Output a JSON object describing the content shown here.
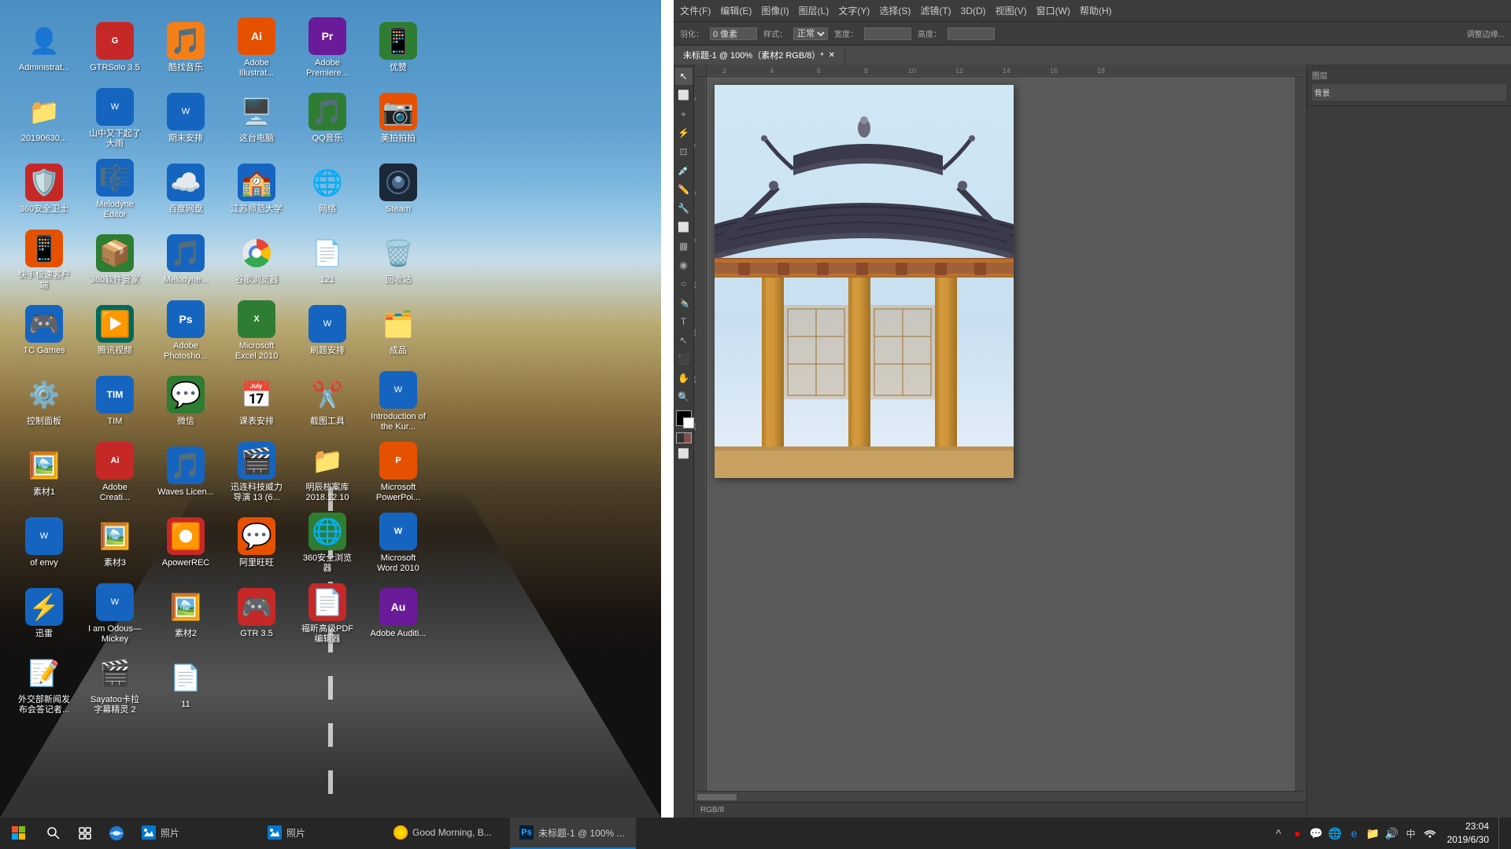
{
  "desktop": {
    "icons": [
      {
        "id": "my-computer",
        "label": "这台电脑",
        "emoji": "🖥️",
        "color": "icon-blue"
      },
      {
        "id": "qq-music",
        "label": "QQ音乐",
        "emoji": "🎵",
        "color": "icon-green"
      },
      {
        "id": "beauty-camera",
        "label": "美拍拍拍",
        "emoji": "📷",
        "color": "icon-orange"
      },
      {
        "id": "360-security",
        "label": "360安全卫士",
        "emoji": "🛡️",
        "color": "icon-red"
      },
      {
        "id": "melodyne-editor",
        "label": "Melodyne Editor",
        "emoji": "🎼",
        "color": "icon-blue"
      },
      {
        "id": "baidu-pan",
        "label": "百度网盘",
        "emoji": "☁️",
        "color": "icon-blue"
      },
      {
        "id": "jiangsu-normal",
        "label": "江苏师范大学",
        "emoji": "🏫",
        "color": "icon-blue"
      },
      {
        "id": "network",
        "label": "网络",
        "emoji": "🌐",
        "color": "icon-none"
      },
      {
        "id": "steam",
        "label": "Steam",
        "emoji": "🎮",
        "color": "icon-none"
      },
      {
        "id": "kuaishou",
        "label": "快手极速客户端",
        "emoji": "📱",
        "color": "icon-orange"
      },
      {
        "id": "360-compress",
        "label": "360软件管家",
        "emoji": "📦",
        "color": "icon-green"
      },
      {
        "id": "melodyne2",
        "label": "Melodyne...",
        "emoji": "🎵",
        "color": "icon-blue"
      },
      {
        "id": "chrome",
        "label": "谷歌浏览器",
        "emoji": "🌐",
        "color": "icon-red"
      },
      {
        "id": "file-121",
        "label": "121",
        "emoji": "📄",
        "color": "icon-none"
      },
      {
        "id": "recycle",
        "label": "回收站",
        "emoji": "🗑️",
        "color": "icon-none"
      },
      {
        "id": "tc-games",
        "label": "TC Games",
        "emoji": "🎮",
        "color": "icon-blue"
      },
      {
        "id": "tencent-video",
        "label": "腾讯视频",
        "emoji": "▶️",
        "color": "icon-teal"
      },
      {
        "id": "ps",
        "label": "Adobe Photosho...",
        "emoji": "Ps",
        "color": "icon-blue"
      },
      {
        "id": "excel2010",
        "label": "Microsoft Excel 2010",
        "emoji": "📊",
        "color": "icon-green"
      },
      {
        "id": "shuati",
        "label": "刷题安排",
        "emoji": "📝",
        "color": "icon-blue"
      },
      {
        "id": "chengpin",
        "label": "成品",
        "emoji": "🗂️",
        "color": "icon-none"
      },
      {
        "id": "control-panel",
        "label": "控制面板",
        "emoji": "⚙️",
        "color": "icon-none"
      },
      {
        "id": "tim",
        "label": "TIM",
        "emoji": "💬",
        "color": "icon-blue"
      },
      {
        "id": "wechat",
        "label": "微信",
        "emoji": "💬",
        "color": "icon-green"
      },
      {
        "id": "kebiao",
        "label": "课表安排",
        "emoji": "📅",
        "color": "icon-none"
      },
      {
        "id": "jiedian",
        "label": "截图工具",
        "emoji": "✂️",
        "color": "icon-none"
      },
      {
        "id": "introduction-kur",
        "label": "Introduction of the Kur...",
        "emoji": "📄",
        "color": "icon-blue"
      },
      {
        "id": "sucai1",
        "label": "素材1",
        "emoji": "🖼️",
        "color": "icon-none"
      },
      {
        "id": "adobe-creative",
        "label": "Adobe Creati...",
        "emoji": "Ai",
        "color": "icon-red"
      },
      {
        "id": "waves",
        "label": "Waves Licen...",
        "emoji": "🎵",
        "color": "icon-blue"
      },
      {
        "id": "xunlian",
        "label": "迅连科技威力导演 13 (6...",
        "emoji": "🎬",
        "color": "icon-blue"
      },
      {
        "id": "mingchen",
        "label": "明辰档案库 2018.12.10",
        "emoji": "📁",
        "color": "icon-none"
      },
      {
        "id": "powerpoint",
        "label": "Microsoft PowerPoi...",
        "emoji": "📊",
        "color": "icon-orange"
      },
      {
        "id": "of-envy",
        "label": "of envy",
        "emoji": "📄",
        "color": "icon-blue"
      },
      {
        "id": "sucai3",
        "label": "素材3",
        "emoji": "🖼️",
        "color": "icon-none"
      },
      {
        "id": "apowerrec",
        "label": "ApowerREC",
        "emoji": "⏺️",
        "color": "icon-red"
      },
      {
        "id": "alibaba",
        "label": "阿里旺旺",
        "emoji": "💬",
        "color": "icon-orange"
      },
      {
        "id": "360-browser",
        "label": "360安全浏览器",
        "emoji": "🌐",
        "color": "icon-green"
      },
      {
        "id": "word2010",
        "label": "Microsoft Word 2010",
        "emoji": "📝",
        "color": "icon-blue"
      },
      {
        "id": "xunda",
        "label": "迅雷",
        "emoji": "⚡",
        "color": "icon-blue"
      },
      {
        "id": "i-am-odus",
        "label": "I am Odous—Mickey",
        "emoji": "📄",
        "color": "icon-blue"
      },
      {
        "id": "sucai2",
        "label": "素材2",
        "emoji": "🖼️",
        "color": "icon-none"
      },
      {
        "id": "gtr35",
        "label": "GTR 3.5",
        "emoji": "🎮",
        "color": "icon-red"
      },
      {
        "id": "gaoxiao-pdf",
        "label": "福昕高级PDF编辑器",
        "emoji": "📄",
        "color": "icon-red"
      },
      {
        "id": "adobe-audition",
        "label": "Adobe Auditi...",
        "emoji": "Au",
        "color": "icon-purple"
      },
      {
        "id": "waijiao",
        "label": "外交部新闻发布会答记者...",
        "emoji": "📝",
        "color": "icon-none"
      },
      {
        "id": "sayatoo",
        "label": "Sayatoo卡拉字幕精灵 2",
        "emoji": "🎬",
        "color": "icon-none"
      },
      {
        "id": "file-11",
        "label": "11",
        "emoji": "📄",
        "color": "icon-none"
      },
      {
        "id": "administrator",
        "label": "Administrat...",
        "emoji": "👤",
        "color": "icon-none"
      },
      {
        "id": "gtrsolo",
        "label": "GTRSolo 3.5",
        "emoji": "🎮",
        "color": "icon-red"
      },
      {
        "id": "zuomei",
        "label": "酷找音乐",
        "emoji": "🎵",
        "color": "icon-yellow"
      },
      {
        "id": "ai",
        "label": "Adobe Illustrat...",
        "emoji": "Ai",
        "color": "icon-orange"
      },
      {
        "id": "premiere",
        "label": "Adobe Premiere...",
        "emoji": "Pr",
        "color": "icon-purple"
      },
      {
        "id": "youzan",
        "label": "优赞",
        "emoji": "📱",
        "color": "icon-green"
      },
      {
        "id": "file-20190630",
        "label": "20190630...",
        "emoji": "📁",
        "color": "icon-none"
      },
      {
        "id": "wenzhang",
        "label": "山中又下起了大雨",
        "emoji": "📄",
        "color": "icon-blue"
      },
      {
        "id": "qimo",
        "label": "期末安排",
        "emoji": "📄",
        "color": "icon-blue"
      }
    ]
  },
  "photoshop": {
    "title": "未标题-1 @ 100%（素材2 RGB/8）*",
    "menubar": [
      "文件(F)",
      "编辑(E)",
      "图像(I)",
      "图层(L)",
      "文字(Y)",
      "选择(S)",
      "滤镜(T)",
      "3D(D)",
      "视图(V)",
      "窗口(W)",
      "帮助(H)"
    ],
    "toolbar": {
      "羽化": "0 像素",
      "样式": "正常",
      "宽度": "",
      "高度": ""
    },
    "tab": "未标题-1 @ 100%（素材2 RGB/8）*",
    "status": "RGB/8",
    "zoom": "100%"
  },
  "taskbar": {
    "apps": [
      {
        "id": "photos1",
        "label": "照片",
        "active": false
      },
      {
        "id": "photos2",
        "label": "照片",
        "active": false
      },
      {
        "id": "morning",
        "label": "Good Morning, B...",
        "active": false
      },
      {
        "id": "ps-task",
        "label": "未标题-1 @ 100% ...",
        "active": true
      }
    ],
    "tray": {
      "time": "23:04",
      "date": "2019/6/30",
      "ime": "中"
    }
  }
}
